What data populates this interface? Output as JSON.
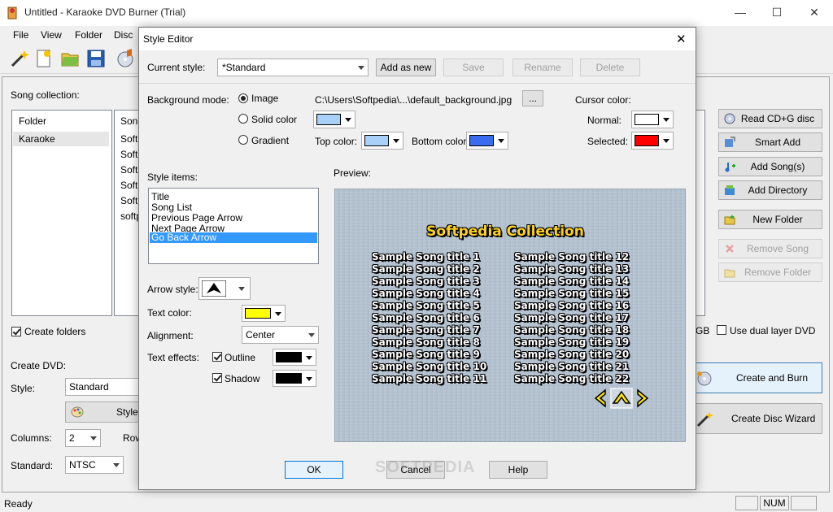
{
  "window": {
    "title": "Untitled - Karaoke DVD Burner (Trial)",
    "controls": {
      "minimize": "—",
      "maximize": "☐",
      "close": "✕"
    }
  },
  "menu": [
    "File",
    "View",
    "Folder",
    "Disc"
  ],
  "toolbar": {
    "icons": [
      "wand-icon",
      "new-document-icon",
      "open-folder-icon",
      "save-icon",
      "music-disc-icon"
    ]
  },
  "main": {
    "song_collection_label": "Song collection:",
    "folders": [
      "Folder",
      "Karaoke"
    ],
    "songs": [
      "Song",
      "Soft",
      "Soft",
      "Soft",
      "Soft",
      "Soft",
      "softp"
    ],
    "create_folders_label": "Create folders",
    "create_dvd_label": "Create DVD:",
    "style_label": "Style:",
    "style_value": "Standard",
    "style_button": "Style",
    "columns_label": "Columns:",
    "columns_value": "2",
    "rows_label": "Row",
    "standard_label": "Standard:",
    "standard_value": "NTSC",
    "gb_fragment": "GB",
    "dual_layer_label": "Use dual layer DVD",
    "side_buttons": {
      "read_cdg": "Read CD+G disc",
      "smart_add": "Smart Add",
      "add_songs": "Add Song(s)",
      "add_directory": "Add Directory",
      "new_folder": "New Folder",
      "remove_song": "Remove Song",
      "remove_folder": "Remove Folder"
    },
    "create_burn": "Create and Burn",
    "create_wizard": "Create Disc Wizard"
  },
  "status": {
    "text": "Ready",
    "num": "NUM"
  },
  "dialog": {
    "title": "Style Editor",
    "close": "✕",
    "current_style_label": "Current style:",
    "current_style_value": "*Standard",
    "add_as_new": "Add as new",
    "save": "Save",
    "rename": "Rename",
    "delete": "Delete",
    "background_mode_label": "Background mode:",
    "bg_image": "Image",
    "bg_solid": "Solid color",
    "bg_gradient": "Gradient",
    "image_path": "C:\\Users\\Softpedia\\...\\default_background.jpg",
    "browse": "...",
    "top_color_label": "Top color:",
    "bottom_color_label": "Bottom color:",
    "cursor_color_label": "Cursor color:",
    "normal_label": "Normal:",
    "selected_label": "Selected:",
    "colors": {
      "solid": "#a8d0f8",
      "top": "#a8d0f8",
      "bottom": "#3a6cf0",
      "normal": "#ffffff",
      "selected": "#ff0000",
      "text": "#ffff00",
      "outline": "#000000",
      "shadow": "#000000",
      "highlight": "#3399ff"
    },
    "style_items_label": "Style items:",
    "style_items": [
      "Title",
      "Song List",
      "Previous Page Arrow",
      "Next Page Arrow",
      "Go Back Arrow"
    ],
    "selected_item_index": 4,
    "arrow_style_label": "Arrow style:",
    "text_color_label": "Text color:",
    "alignment_label": "Alignment:",
    "alignment_value": "Center",
    "text_effects_label": "Text effects:",
    "outline_label": "Outline",
    "shadow_label": "Shadow",
    "preview_label": "Preview:",
    "preview_title": "Softpedia Collection",
    "preview_songs_left": [
      "Sample Song title 1",
      "Sample Song title 2",
      "Sample Song title 3",
      "Sample Song title 4",
      "Sample Song title 5",
      "Sample Song title 6",
      "Sample Song title 7",
      "Sample Song title 8",
      "Sample Song title 9",
      "Sample Song title 10",
      "Sample Song title 11"
    ],
    "preview_songs_right": [
      "Sample Song title 12",
      "Sample Song title 13",
      "Sample Song title 14",
      "Sample Song title 15",
      "Sample Song title 16",
      "Sample Song title 17",
      "Sample Song title 18",
      "Sample Song title 19",
      "Sample Song title 20",
      "Sample Song title 21",
      "Sample Song title 22"
    ],
    "ok": "OK",
    "cancel": "Cancel",
    "help": "Help"
  },
  "watermark": "SOFTPEDIA"
}
